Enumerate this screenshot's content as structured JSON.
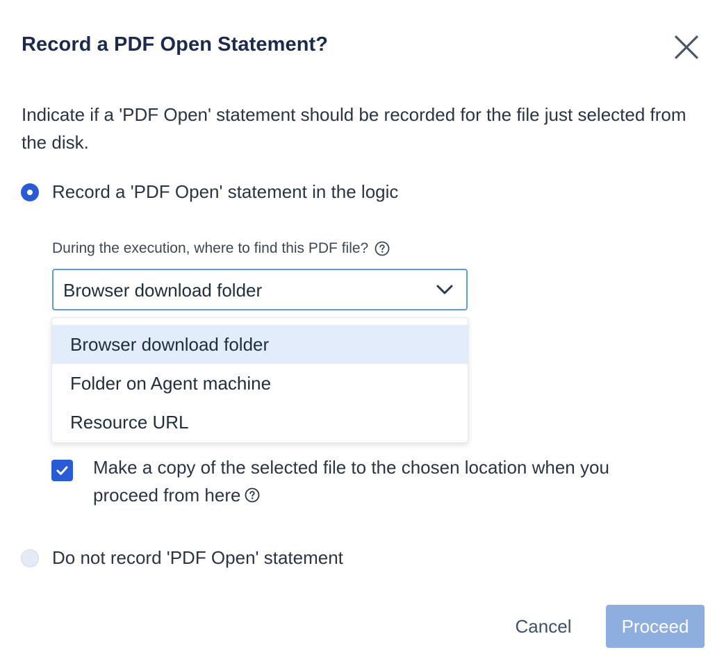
{
  "dialog": {
    "title": "Record a PDF Open Statement?",
    "description": "Indicate if a 'PDF Open' statement should be recorded for the file just selected from the disk."
  },
  "options": {
    "record_label": "Record a 'PDF Open' statement in the logic",
    "record_selected": true,
    "do_not_record_label": "Do not record 'PDF Open' statement",
    "do_not_record_selected": false
  },
  "location": {
    "field_label": "During the execution, where to find this PDF file?",
    "selected_value": "Browser download folder",
    "dropdown_open": true,
    "options": [
      "Browser download folder",
      "Folder on Agent machine",
      "Resource URL"
    ]
  },
  "copy_file": {
    "checked": true,
    "label": "Make a copy of the selected file to the chosen location when you proceed from here"
  },
  "footer": {
    "cancel_label": "Cancel",
    "proceed_label": "Proceed"
  },
  "colors": {
    "accent": "#2a5bd7",
    "title": "#1b2a4e",
    "focus_border": "#5b9be0",
    "highlight": "#e3ecfa",
    "proceed_disabled": "#8eaedf"
  },
  "icons": {
    "close": "close-icon",
    "help": "question-circle-icon",
    "chevron": "chevron-down-icon",
    "check": "checkmark-icon"
  }
}
